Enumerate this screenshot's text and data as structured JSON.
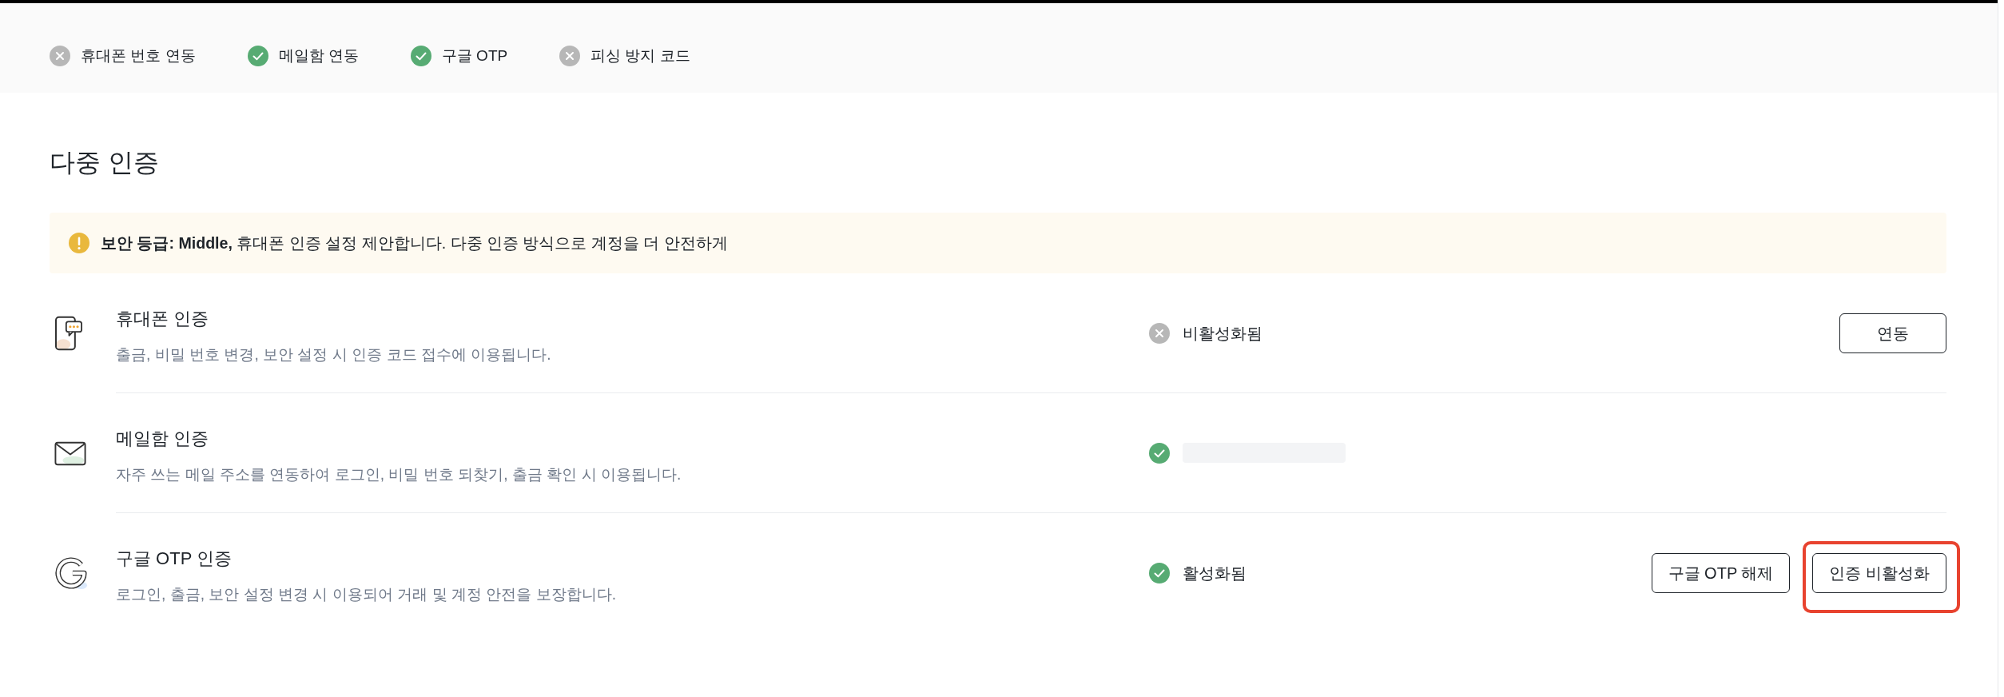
{
  "header": {
    "checklist": [
      {
        "label": "휴대폰 번호 연동",
        "done": false
      },
      {
        "label": "메일함 연동",
        "done": true
      },
      {
        "label": "구글 OTP",
        "done": true
      },
      {
        "label": "피싱 방지 코드",
        "done": false
      }
    ]
  },
  "multi_factor": {
    "title": "다중 인증",
    "notice": {
      "text": "**보안 등급: Middle,** 휴대폰 인증 설정 제안합니다. 다중 인증 방식으로 계정을 더 안전하게"
    },
    "methods": [
      {
        "kind": "phone",
        "title": "휴대폰 인증",
        "description": "출금, 비밀 번호 변경, 보안 설정 시 인증 코드 접수에 이용됩니다.",
        "status": {
          "enabled": false,
          "label": "비활성화됨"
        },
        "buttons": [
          {
            "label": "연동",
            "highlighted": false
          }
        ]
      },
      {
        "kind": "email",
        "title": "메일함 인증",
        "description": "자주 쓰는 메일 주소를 연동하여 로그인, 비밀 번호 되찾기, 출금 확인 시 이용됩니다.",
        "status": {
          "enabled": true,
          "redacted": true
        }
      },
      {
        "kind": "otp",
        "title": "구글 OTP 인증",
        "description": "로그인, 출금, 보안 설정 변경 시 이용되어 거래 및 계정 안전을 보장합니다.",
        "status": {
          "enabled": true,
          "label": "활성화됨"
        },
        "buttons": [
          {
            "label": "구글 OTP 해제",
            "highlighted": false
          },
          {
            "label": "인증 비활성화",
            "highlighted": true
          }
        ]
      }
    ]
  }
}
